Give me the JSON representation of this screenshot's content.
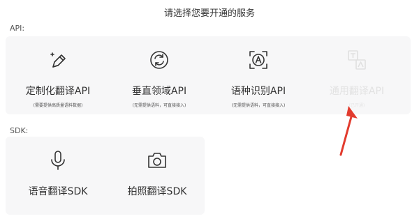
{
  "page": {
    "title": "请选择您要开通的服务"
  },
  "api_section": {
    "label": "API:",
    "cards": [
      {
        "name": "定制化翻译API",
        "desc": "(需要提供高质量语料数据)",
        "icon": "pencil-edit-icon"
      },
      {
        "name": "垂直领域API",
        "desc": "(无需提供语料，可直接接入)",
        "icon": "refresh-cycle-icon"
      },
      {
        "name": "语种识别API",
        "desc": "(无需提供语料，可直接接入)",
        "icon": "letter-a-scan-icon"
      },
      {
        "name": "通用翻译API",
        "desc": "(已开通)",
        "icon": "translate-icon"
      }
    ]
  },
  "sdk_section": {
    "label": "SDK:",
    "cards": [
      {
        "name": "语音翻译SDK",
        "icon": "microphone-icon"
      },
      {
        "name": "拍照翻译SDK",
        "icon": "camera-icon"
      }
    ]
  },
  "colors": {
    "annotation_arrow": "#e23b2e",
    "panel_bg": "#f7f7f8",
    "disabled_text": "#e2e2e2"
  }
}
